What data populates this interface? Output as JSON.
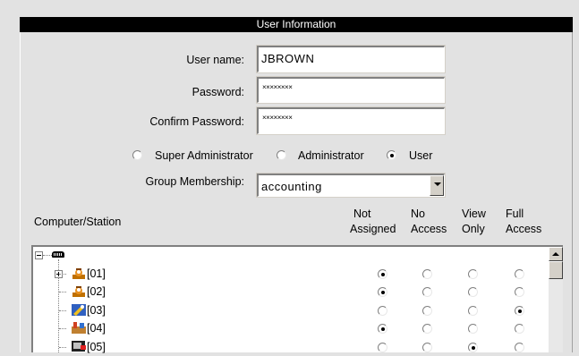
{
  "section_title": "User Information",
  "form": {
    "username_label": "User name:",
    "username_value": "JBROWN",
    "password_label": "Password:",
    "password_value": "××××××××",
    "confirm_label": "Confirm Password:",
    "confirm_value": "××××××××"
  },
  "roles": {
    "options": [
      "Super Administrator",
      "Administrator",
      "User"
    ],
    "selected": "User"
  },
  "group": {
    "label": "Group Membership:",
    "value": "accounting"
  },
  "table": {
    "station_header": "Computer/Station",
    "columns": [
      {
        "line1": "Not",
        "line2": "Assigned"
      },
      {
        "line1": "No",
        "line2": "Access"
      },
      {
        "line1": "View",
        "line2": "Only"
      },
      {
        "line1": "Full",
        "line2": "Access"
      }
    ],
    "rows": [
      {
        "label": "[01]",
        "icon": "user-station-icon",
        "selected": 0
      },
      {
        "label": "[02]",
        "icon": "user-station-icon",
        "selected": 0
      },
      {
        "label": "[03]",
        "icon": "wrench-station-icon",
        "selected": 3
      },
      {
        "label": "[04]",
        "icon": "tools-station-icon",
        "selected": 0
      },
      {
        "label": "[05]",
        "icon": "monitor-station-icon",
        "selected": 2
      }
    ]
  },
  "colors": {
    "title_bar": "#000000",
    "panel_background": "#e2e2e2"
  }
}
